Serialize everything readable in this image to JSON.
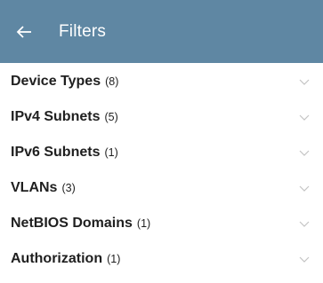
{
  "header": {
    "title": "Filters",
    "back_icon": "back-arrow-icon",
    "background_color": "#5f87a3"
  },
  "filters": [
    {
      "label": "Device Types",
      "count": "(8)"
    },
    {
      "label": "IPv4 Subnets",
      "count": "(5)"
    },
    {
      "label": "IPv6 Subnets",
      "count": "(1)"
    },
    {
      "label": "VLANs",
      "count": "(3)"
    },
    {
      "label": "NetBIOS Domains",
      "count": "(1)"
    },
    {
      "label": "Authorization",
      "count": "(1)"
    }
  ],
  "row_icon": "chevron-down-icon"
}
